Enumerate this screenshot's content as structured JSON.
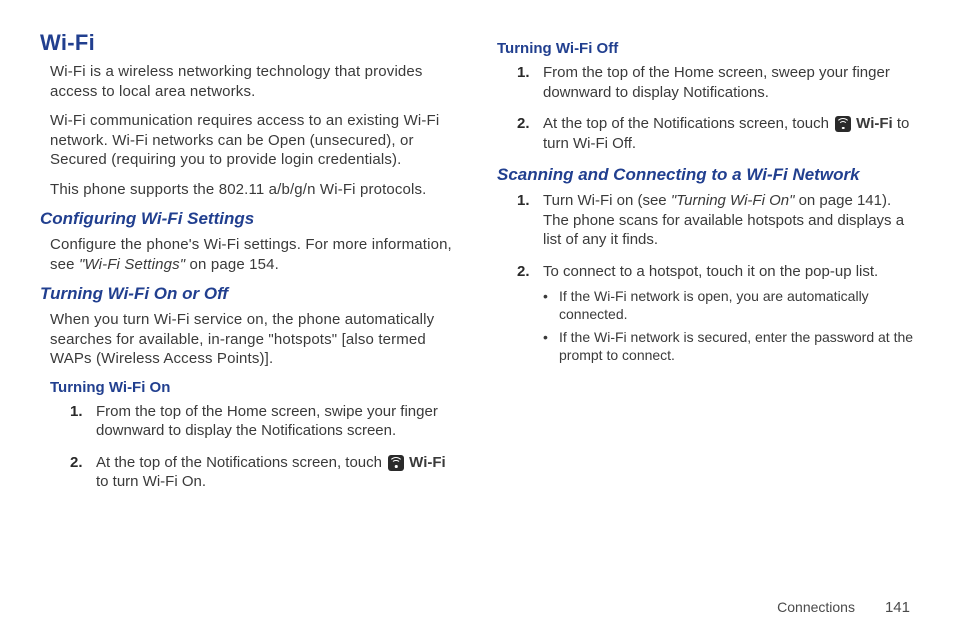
{
  "left": {
    "h1": "Wi-Fi",
    "p1": "Wi-Fi is a wireless networking technology that provides access to local area networks.",
    "p2": "Wi-Fi communication requires access to an existing Wi-Fi network. Wi-Fi networks can be Open (unsecured), or Secured (requiring you to provide login credentials).",
    "p3": "This phone supports the 802.11 a/b/g/n Wi-Fi protocols.",
    "conf_h2": "Configuring Wi-Fi Settings",
    "conf_p_pre": "Configure the phone's Wi-Fi settings. For more information, see ",
    "conf_p_ref": "\"Wi-Fi Settings\"",
    "conf_p_post": " on page 154.",
    "onoff_h2": "Turning Wi-Fi On or Off",
    "onoff_p": "When you turn Wi-Fi service on, the phone automatically searches for available, in-range \"hotspots\" [also termed WAPs (Wireless Access Points)].",
    "on_h3": "Turning Wi-Fi On",
    "on_step1_num": "1.",
    "on_step1": "From the top of the Home screen, swipe your finger downward to display the Notifications screen.",
    "on_step2_num": "2.",
    "on_step2_pre": "At the top of the Notifications screen, touch ",
    "on_step2_label": "Wi-Fi",
    "on_step2_post": " to turn Wi-Fi On."
  },
  "right": {
    "off_h3": "Turning Wi-Fi Off",
    "off_step1_num": "1.",
    "off_step1": "From the top of the Home screen, sweep your finger downward to display Notifications.",
    "off_step2_num": "2.",
    "off_step2_pre": "At the top of the Notifications screen, touch ",
    "off_step2_label": "Wi-Fi",
    "off_step2_post": " to turn Wi-Fi Off.",
    "scan_h2": "Scanning and Connecting to a Wi-Fi Network",
    "scan_step1_num": "1.",
    "scan_step1_pre": "Turn Wi-Fi on (see ",
    "scan_step1_ref": "\"Turning Wi-Fi On\"",
    "scan_step1_post": " on page 141). The phone scans for available hotspots and displays a list of any it finds.",
    "scan_step2_num": "2.",
    "scan_step2": "To connect to a hotspot, touch it on the pop-up list.",
    "scan_b1": "If the Wi-Fi network is open, you are automatically connected.",
    "scan_b2": "If the Wi-Fi network is secured, enter the password at the prompt to connect."
  },
  "footer": {
    "section": "Connections",
    "page": "141"
  }
}
